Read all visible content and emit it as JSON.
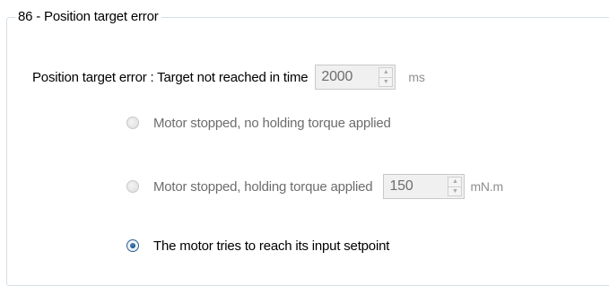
{
  "group": {
    "title": "86 - Position target error"
  },
  "timeout": {
    "label": "Position target error : Target not reached in time",
    "value": "2000",
    "unit": "ms"
  },
  "options": [
    {
      "label": "Motor stopped, no holding torque applied",
      "selected": false,
      "enabled": false
    },
    {
      "label": "Motor stopped, holding torque applied",
      "selected": false,
      "enabled": false,
      "torque_value": "150",
      "torque_unit": "mN.m"
    },
    {
      "label": "The motor tries to reach its input setpoint",
      "selected": true,
      "enabled": true
    }
  ],
  "colors": {
    "disabled_text": "#6d6d6d",
    "unit_text": "#8e8e8e",
    "groupbox_border": "#d5dfe5",
    "radio_selected": "#2f5f8f"
  },
  "icons": {
    "spin_up": "up-arrow-icon",
    "spin_down": "down-arrow-icon"
  }
}
